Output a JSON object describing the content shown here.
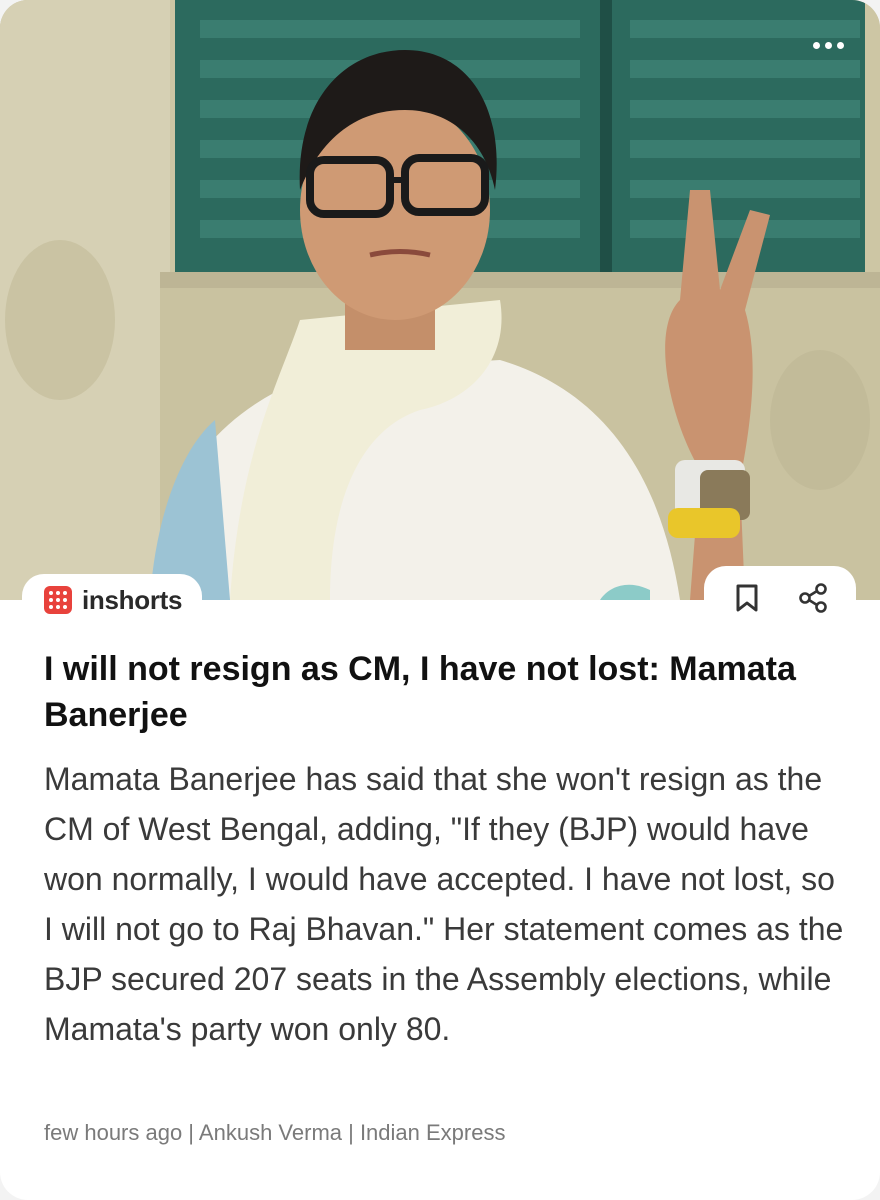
{
  "header": {
    "more_icon": "more-horizontal-icon"
  },
  "brand": {
    "name": "inshorts",
    "logo_color": "#e8423c"
  },
  "actions": {
    "bookmark_icon": "bookmark-icon",
    "share_icon": "share-icon"
  },
  "article": {
    "headline": "I will not resign as CM, I have not lost: Mamata Banerjee",
    "body": "Mamata Banerjee has said that she won't resign as the CM of West Bengal, adding, \"If they (BJP) would have won normally, I would have accepted. I have not lost, so I will not go to Raj Bhavan.\" Her statement comes as the BJP secured 207 seats in the Assembly elections, while Mamata's party won only 80.",
    "meta": "few hours ago | Ankush Verma | Indian Express"
  },
  "colors": {
    "shutter": "#2f6f63",
    "wall": "#cfc9a8",
    "text": "#111111",
    "muted": "#7a7a7a"
  }
}
